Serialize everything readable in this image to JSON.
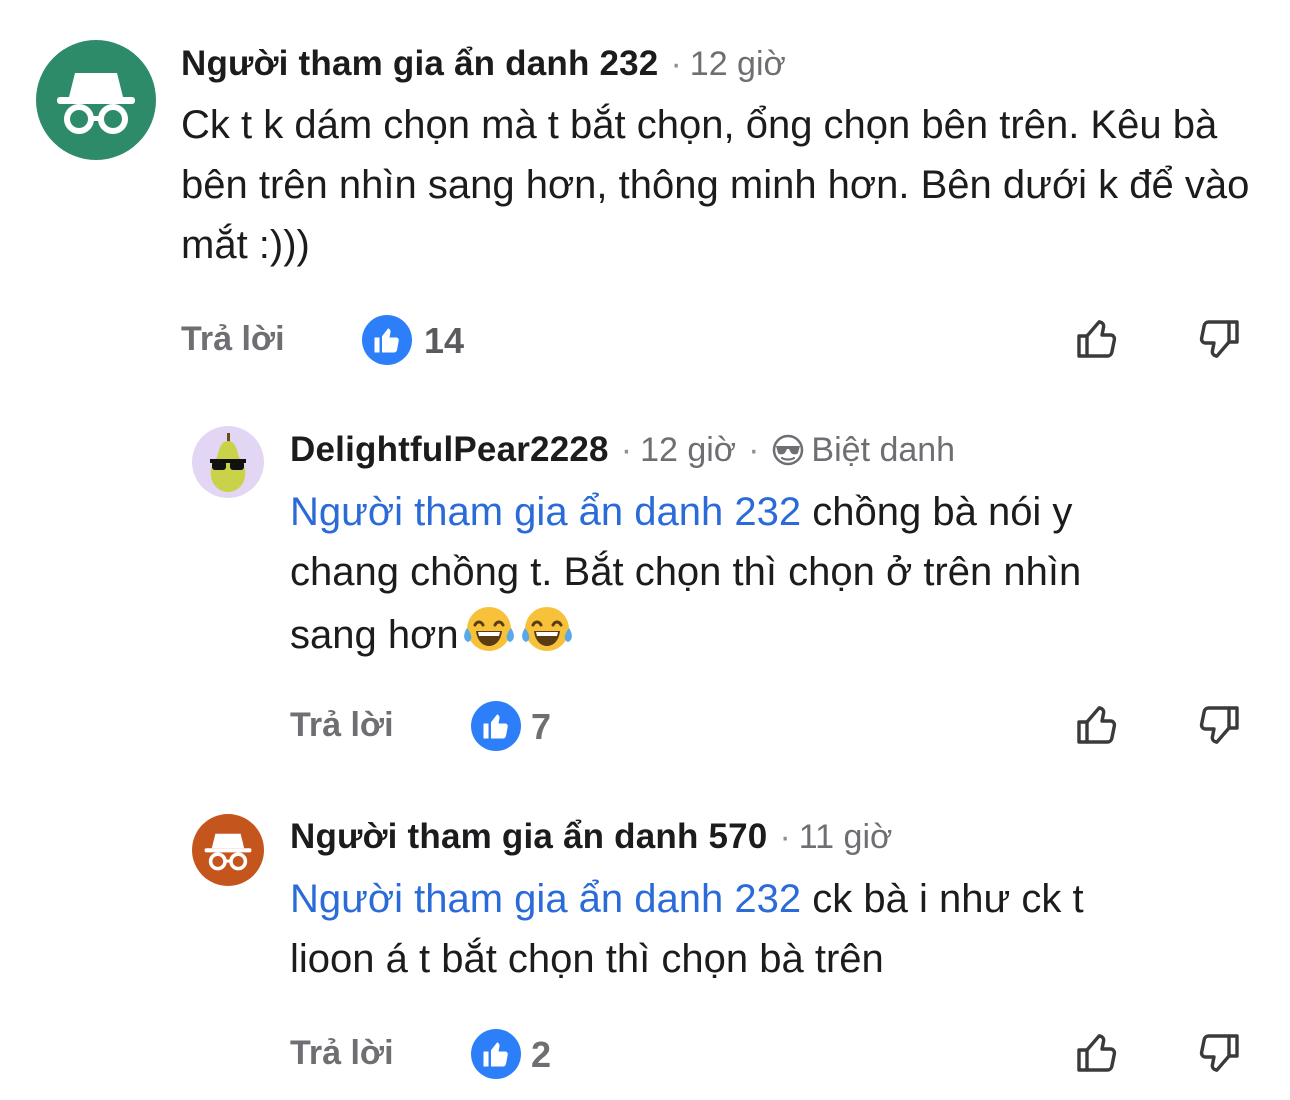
{
  "comments": [
    {
      "author": "Người tham gia ẩn danh 232",
      "sep": "·",
      "time": "12 giờ",
      "text": "Ck t k dám chọn mà t bắt chọn, ổng chọn bên trên. Kêu bà bên trên nhìn sang hơn, thông minh hơn. Bên dưới k để vào mắt :)))",
      "reply_label": "Trả lời",
      "like_count": "14",
      "avatar_color": "#2e8b6a",
      "avatar_icon": "incognito-icon"
    },
    {
      "author": "DelightfulPear2228",
      "sep": "·",
      "time": "12 giờ",
      "sep2": "·",
      "nickname_label": "Biệt danh",
      "mention": "Người tham gia ẩn danh 232",
      "text_line1": " chồng bà nói y",
      "text_line2": "chang chồng t. Bắt chọn thì chọn ở trên nhìn",
      "text_line3": "sang hơn",
      "emojis": [
        "😂",
        "😂"
      ],
      "reply_label": "Trả lời",
      "like_count": "7",
      "avatar_color": "#e3d6f4",
      "avatar_icon": "pear-sunglasses-icon"
    },
    {
      "author": "Người tham gia ẩn danh 570",
      "sep": "·",
      "time": "11 giờ",
      "mention": "Người tham gia ẩn danh 232",
      "text_line1": " ck bà i như ck t",
      "text_line2": "lioon á t bắt chọn thì chọn bà trên",
      "reply_label": "Trả lời",
      "like_count": "2",
      "avatar_color": "#c4561d",
      "avatar_icon": "incognito-icon"
    }
  ],
  "colors": {
    "mention": "#2a6bd8",
    "like_badge": "#2d7ff9",
    "secondary_text": "#6e6e73"
  }
}
